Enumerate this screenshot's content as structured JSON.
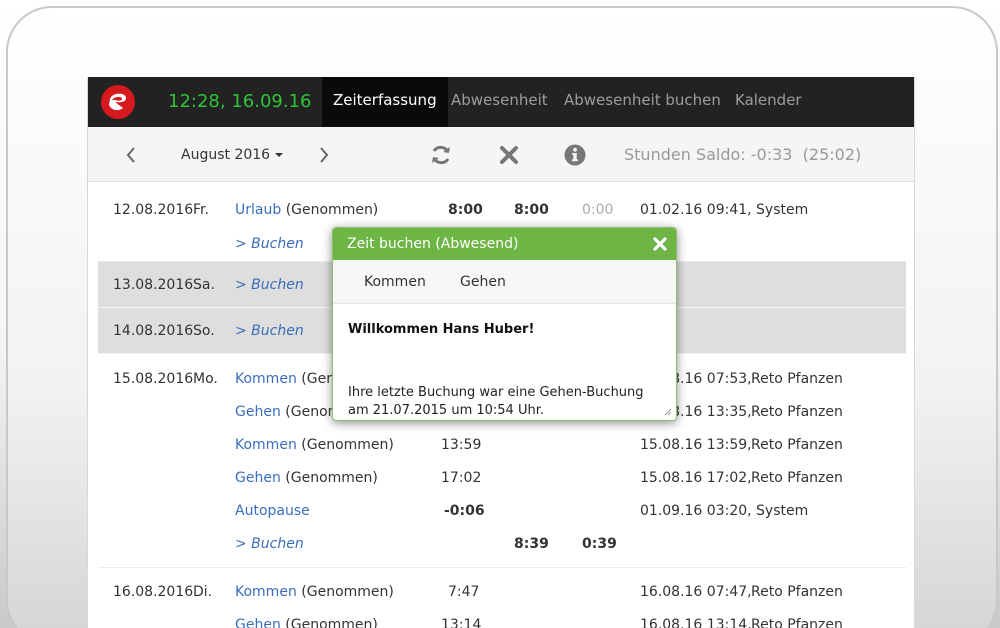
{
  "nav": {
    "clock": "12:28, 16.09.16",
    "tabs": [
      {
        "label": "Zeiterfassung",
        "active": true
      },
      {
        "label": "Abwesenheit",
        "active": false
      },
      {
        "label": "Abwesenheit buchen",
        "active": false
      },
      {
        "label": "Kalender",
        "active": false
      }
    ]
  },
  "toolbar": {
    "month": "August 2016",
    "saldo": "Stunden Saldo: -0:33  (25:02)"
  },
  "rows": {
    "d12": {
      "date": "12.08.2016",
      "weekday": "Fr.",
      "type": "Urlaub",
      "status": "(Genommen)",
      "c1": "8:00",
      "c2": "8:00",
      "c3": "0:00",
      "info": "01.02.16 09:41, System",
      "buchen": "> Buchen"
    },
    "d13": {
      "date": "13.08.2016",
      "weekday": "Sa.",
      "buchen": "> Buchen"
    },
    "d14": {
      "date": "14.08.2016",
      "weekday": "So.",
      "buchen": "> Buchen"
    },
    "d15": {
      "date": "15.08.2016",
      "weekday": "Mo.",
      "e1": {
        "type": "Kommen",
        "status": "(Genommen)",
        "time": "",
        "info": "15.08.16 07:53,",
        "user": "Reto Pfanzen"
      },
      "e2": {
        "type": "Gehen",
        "status": "(Genommen)",
        "time": "",
        "info": "15.08.16 13:35,",
        "user": "Reto Pfanzen"
      },
      "e3": {
        "type": "Kommen",
        "status": "(Genommen)",
        "time": "13:59",
        "info": "15.08.16 13:59,",
        "user": "Reto Pfanzen"
      },
      "e4": {
        "type": "Gehen",
        "status": "(Genommen)",
        "time": "17:02",
        "info": "15.08.16 17:02,",
        "user": "Reto Pfanzen"
      },
      "e5": {
        "type": "Autopause",
        "time": "-0:06",
        "info": "01.09.16 03:20, System"
      },
      "buchen": "> Buchen",
      "total": "8:39",
      "diff": "0:39"
    },
    "d16": {
      "date": "16.08.2016",
      "weekday": "Di.",
      "e1": {
        "type": "Kommen",
        "status": "(Genommen)",
        "time": "7:47",
        "info": "16.08.16 07:47,",
        "user": "Reto Pfanzen"
      },
      "e2": {
        "type": "Gehen",
        "status": "(Genommen)",
        "time": "13:14",
        "info": "16.08.16 13:14,",
        "user": "Reto Pfanzen"
      }
    }
  },
  "modal": {
    "title": "Zeit buchen (Abwesend)",
    "tabs": [
      "Kommen",
      "Gehen"
    ],
    "welcome": "Willkommen Hans Huber!",
    "message": "Ihre letzte Buchung war eine Gehen-Buchung am 21.07.2015 um 10:54 Uhr."
  },
  "colors": {
    "nav_bg": "#222222",
    "clock": "#2ec535",
    "link": "#3a6ebc",
    "modal_header": "#6db544",
    "logo": "#d6181f"
  }
}
